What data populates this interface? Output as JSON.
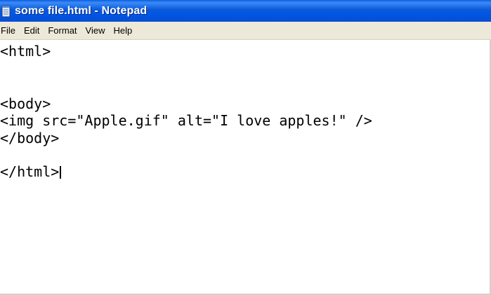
{
  "window": {
    "title": "some file.html - Notepad",
    "icon": "notepad-icon"
  },
  "menu": {
    "items": [
      "File",
      "Edit",
      "Format",
      "View",
      "Help"
    ]
  },
  "editor": {
    "lines": [
      "<html>",
      "",
      "",
      "<body>",
      "<img src=\"Apple.gif\" alt=\"I love apples!\" />",
      "</body>",
      "",
      "</html>"
    ]
  },
  "colors": {
    "titlebar": "#0054e3",
    "menubar": "#ece9d8",
    "editor_background": "#ffffff",
    "text": "#000000"
  }
}
